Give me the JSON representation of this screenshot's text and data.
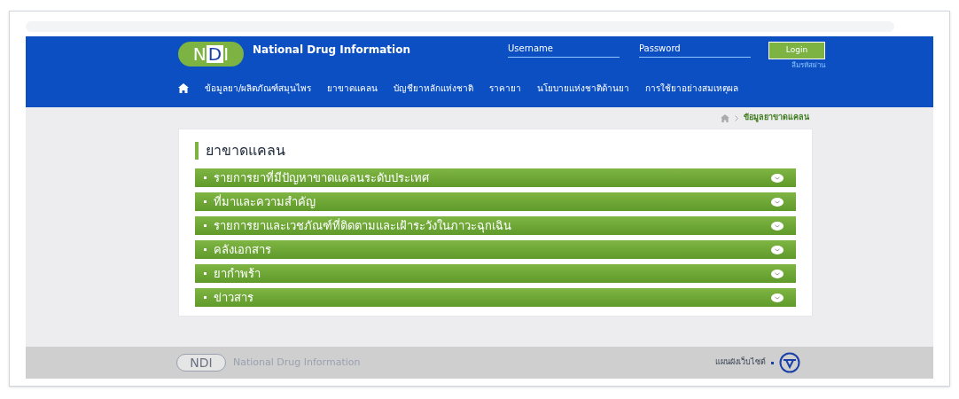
{
  "header": {
    "logo": "NDI",
    "site_title": "National Drug Information",
    "username_placeholder": "Username",
    "password_placeholder": "Password",
    "login_button": "Login",
    "forgot_link": "ลืมรหัสผ่าน"
  },
  "nav": [
    "ข้อมูลยา/ผลิตภัณฑ์สมุนไพร",
    "ยาขาดแคลน",
    "บัญชียาหลักแห่งชาติ",
    "ราคายา",
    "นโยบายแห่งชาติด้านยา",
    "การใช้ยาอย่างสมเหตุผล"
  ],
  "breadcrumb": [
    "ข้อมูลยาขาดแคลน"
  ],
  "section_title": "ยาขาดแคลน",
  "accordion": [
    {
      "label": "รายการยาที่มีปัญหาขาดแคลนระดับประเทศ"
    },
    {
      "label": "ที่มาและความสำคัญ"
    },
    {
      "label": "รายการยาและเวชภัณฑ์ที่ติดตามและเฝ้าระวังในภาวะฉุกเฉิน"
    },
    {
      "label": "คลังเอกสาร"
    },
    {
      "label": "ยากำพร้า"
    },
    {
      "label": "ข่าวสาร"
    }
  ],
  "footer": {
    "logo": "NDI",
    "site_title": "National Drug Information",
    "sitemap_link": "แผนผังเว็บไซต์"
  }
}
